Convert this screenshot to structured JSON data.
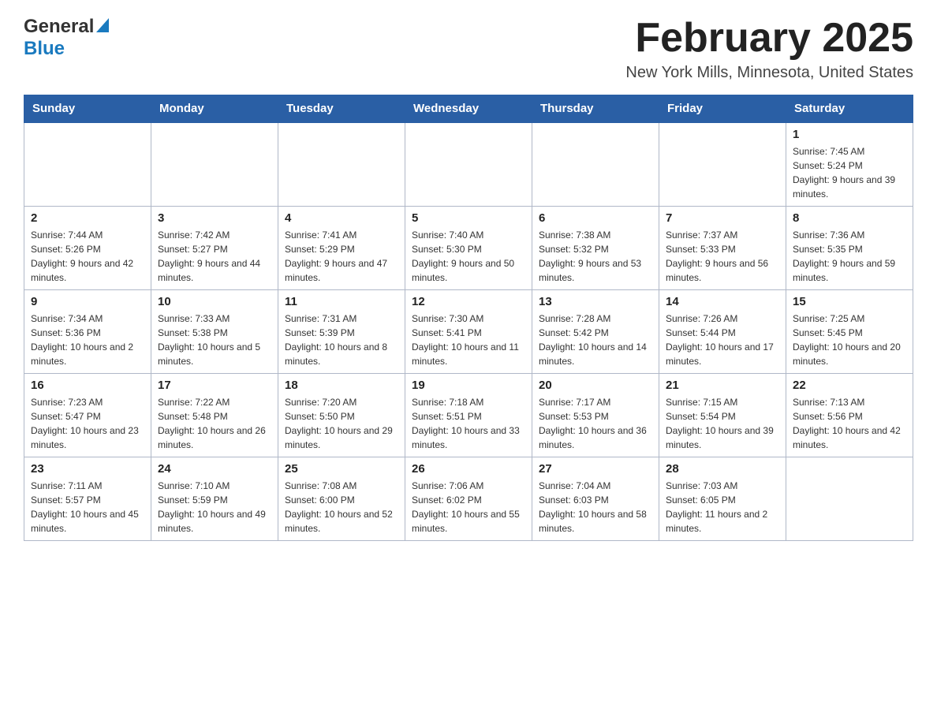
{
  "logo": {
    "general": "General",
    "blue": "Blue"
  },
  "header": {
    "title": "February 2025",
    "subtitle": "New York Mills, Minnesota, United States"
  },
  "weekdays": [
    "Sunday",
    "Monday",
    "Tuesday",
    "Wednesday",
    "Thursday",
    "Friday",
    "Saturday"
  ],
  "weeks": [
    [
      {
        "day": "",
        "info": ""
      },
      {
        "day": "",
        "info": ""
      },
      {
        "day": "",
        "info": ""
      },
      {
        "day": "",
        "info": ""
      },
      {
        "day": "",
        "info": ""
      },
      {
        "day": "",
        "info": ""
      },
      {
        "day": "1",
        "info": "Sunrise: 7:45 AM\nSunset: 5:24 PM\nDaylight: 9 hours and 39 minutes."
      }
    ],
    [
      {
        "day": "2",
        "info": "Sunrise: 7:44 AM\nSunset: 5:26 PM\nDaylight: 9 hours and 42 minutes."
      },
      {
        "day": "3",
        "info": "Sunrise: 7:42 AM\nSunset: 5:27 PM\nDaylight: 9 hours and 44 minutes."
      },
      {
        "day": "4",
        "info": "Sunrise: 7:41 AM\nSunset: 5:29 PM\nDaylight: 9 hours and 47 minutes."
      },
      {
        "day": "5",
        "info": "Sunrise: 7:40 AM\nSunset: 5:30 PM\nDaylight: 9 hours and 50 minutes."
      },
      {
        "day": "6",
        "info": "Sunrise: 7:38 AM\nSunset: 5:32 PM\nDaylight: 9 hours and 53 minutes."
      },
      {
        "day": "7",
        "info": "Sunrise: 7:37 AM\nSunset: 5:33 PM\nDaylight: 9 hours and 56 minutes."
      },
      {
        "day": "8",
        "info": "Sunrise: 7:36 AM\nSunset: 5:35 PM\nDaylight: 9 hours and 59 minutes."
      }
    ],
    [
      {
        "day": "9",
        "info": "Sunrise: 7:34 AM\nSunset: 5:36 PM\nDaylight: 10 hours and 2 minutes."
      },
      {
        "day": "10",
        "info": "Sunrise: 7:33 AM\nSunset: 5:38 PM\nDaylight: 10 hours and 5 minutes."
      },
      {
        "day": "11",
        "info": "Sunrise: 7:31 AM\nSunset: 5:39 PM\nDaylight: 10 hours and 8 minutes."
      },
      {
        "day": "12",
        "info": "Sunrise: 7:30 AM\nSunset: 5:41 PM\nDaylight: 10 hours and 11 minutes."
      },
      {
        "day": "13",
        "info": "Sunrise: 7:28 AM\nSunset: 5:42 PM\nDaylight: 10 hours and 14 minutes."
      },
      {
        "day": "14",
        "info": "Sunrise: 7:26 AM\nSunset: 5:44 PM\nDaylight: 10 hours and 17 minutes."
      },
      {
        "day": "15",
        "info": "Sunrise: 7:25 AM\nSunset: 5:45 PM\nDaylight: 10 hours and 20 minutes."
      }
    ],
    [
      {
        "day": "16",
        "info": "Sunrise: 7:23 AM\nSunset: 5:47 PM\nDaylight: 10 hours and 23 minutes."
      },
      {
        "day": "17",
        "info": "Sunrise: 7:22 AM\nSunset: 5:48 PM\nDaylight: 10 hours and 26 minutes."
      },
      {
        "day": "18",
        "info": "Sunrise: 7:20 AM\nSunset: 5:50 PM\nDaylight: 10 hours and 29 minutes."
      },
      {
        "day": "19",
        "info": "Sunrise: 7:18 AM\nSunset: 5:51 PM\nDaylight: 10 hours and 33 minutes."
      },
      {
        "day": "20",
        "info": "Sunrise: 7:17 AM\nSunset: 5:53 PM\nDaylight: 10 hours and 36 minutes."
      },
      {
        "day": "21",
        "info": "Sunrise: 7:15 AM\nSunset: 5:54 PM\nDaylight: 10 hours and 39 minutes."
      },
      {
        "day": "22",
        "info": "Sunrise: 7:13 AM\nSunset: 5:56 PM\nDaylight: 10 hours and 42 minutes."
      }
    ],
    [
      {
        "day": "23",
        "info": "Sunrise: 7:11 AM\nSunset: 5:57 PM\nDaylight: 10 hours and 45 minutes."
      },
      {
        "day": "24",
        "info": "Sunrise: 7:10 AM\nSunset: 5:59 PM\nDaylight: 10 hours and 49 minutes."
      },
      {
        "day": "25",
        "info": "Sunrise: 7:08 AM\nSunset: 6:00 PM\nDaylight: 10 hours and 52 minutes."
      },
      {
        "day": "26",
        "info": "Sunrise: 7:06 AM\nSunset: 6:02 PM\nDaylight: 10 hours and 55 minutes."
      },
      {
        "day": "27",
        "info": "Sunrise: 7:04 AM\nSunset: 6:03 PM\nDaylight: 10 hours and 58 minutes."
      },
      {
        "day": "28",
        "info": "Sunrise: 7:03 AM\nSunset: 6:05 PM\nDaylight: 11 hours and 2 minutes."
      },
      {
        "day": "",
        "info": ""
      }
    ]
  ]
}
